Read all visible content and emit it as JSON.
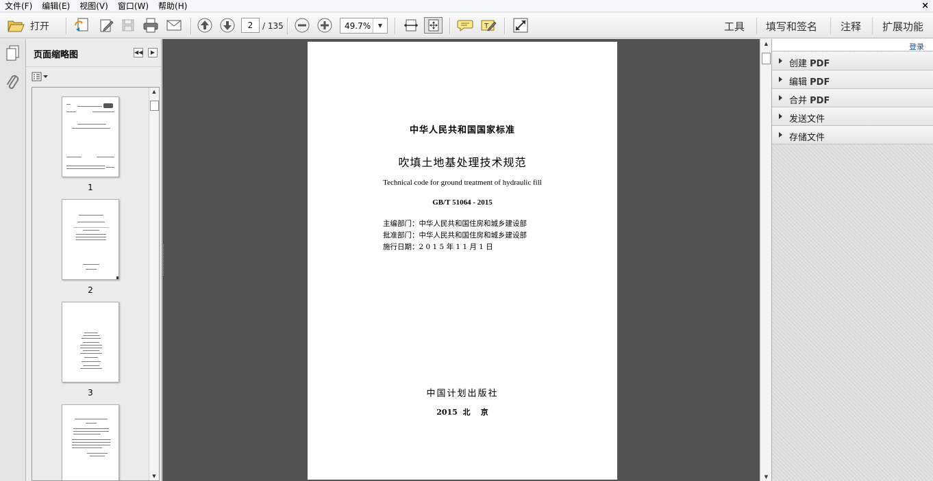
{
  "menu": [
    "文件(F)",
    "编辑(E)",
    "视图(V)",
    "窗口(W)",
    "帮助(H)"
  ],
  "window_close": "×",
  "toolbar": {
    "open_label": "打开",
    "page_current": "2",
    "page_total": "/ 135",
    "zoom": "49.7%",
    "zoom_dropdown": "▼",
    "right_tabs": [
      "工具",
      "填写和签名",
      "注释",
      "扩展功能"
    ]
  },
  "thumbnails": {
    "title": "页面缩略图",
    "collapse": "◀◀",
    "expand": "▶",
    "pages": [
      "1",
      "2",
      "3"
    ],
    "current_page": "2"
  },
  "document": {
    "header": "中华人民共和国国家标准",
    "title": "吹填土地基处理技术规范",
    "title_en": "Technical code for ground treatment of hydraulic fill",
    "code": "GB/T 51064 - 2015",
    "editor_dept": "主编部门：中华人民共和国住房和城乡建设部",
    "approval_dept": "批准部门：中华人民共和国住房和城乡建设部",
    "effective_date": "施行日期：2 0 1 5 年 1 1 月 1 日",
    "publisher": "中国计划出版社",
    "pub_place": "2015  北    京"
  },
  "right_panel": {
    "login": "登录",
    "items": [
      {
        "label": "创建 ",
        "suffix": "PDF"
      },
      {
        "label": "编辑 ",
        "suffix": "PDF"
      },
      {
        "label": "合并 ",
        "suffix": "PDF"
      },
      {
        "label": "发送文件",
        "suffix": ""
      },
      {
        "label": "存储文件",
        "suffix": ""
      }
    ]
  },
  "icons": [
    "open-folder-icon",
    "create-pdf-icon",
    "edit-icon",
    "save-icon",
    "print-icon",
    "email-icon",
    "page-up-icon",
    "page-down-icon",
    "zoom-out-icon",
    "zoom-in-icon",
    "fit-width-icon",
    "fit-page-icon",
    "comment-icon",
    "highlight-icon",
    "fullscreen-icon",
    "pages-panel-icon",
    "attachment-icon",
    "thumb-options-icon"
  ]
}
